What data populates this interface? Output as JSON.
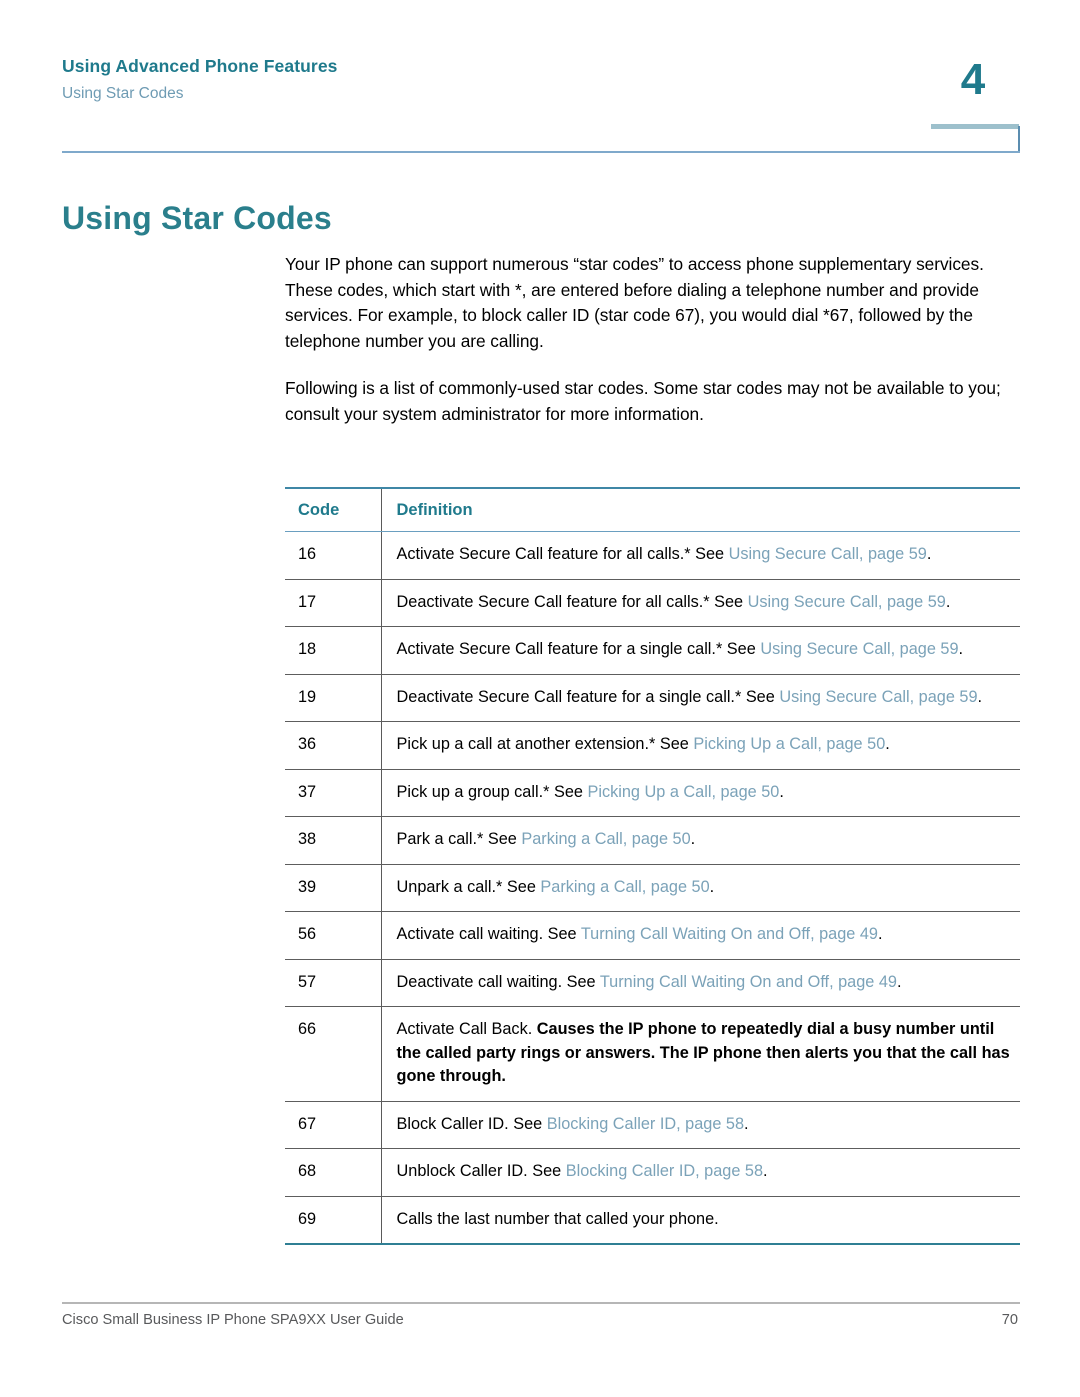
{
  "colors": {
    "heading_teal": "#2a7f8c",
    "runhead_teal": "#1f7a8c",
    "xref_blue": "#7ba2b8",
    "rule_blue": "#7fa9cb",
    "footer_gray": "#58595b"
  },
  "running_head": {
    "title": "Using Advanced Phone Features",
    "subtitle": "Using Star Codes",
    "chapter_number": "4"
  },
  "page_title": "Using Star Codes",
  "paragraphs": [
    "Your IP phone can support numerous “star codes” to access phone supplementary services. These codes, which start with *, are entered before dialing a telephone number and provide services. For example, to block caller ID (star code 67), you would dial *67, followed by the telephone number you are calling.",
    "Following is a list of commonly-used star codes. Some star codes may not be available to you; consult your system administrator for more information."
  ],
  "table": {
    "headers": {
      "code": "Code",
      "definition": "Definition"
    },
    "rows": [
      {
        "code": "16",
        "lead": "Activate Secure Call feature for all calls.* See ",
        "xref": "Using Secure Call, page 59",
        "tail": ".",
        "bold_lead": "",
        "bold_body": ""
      },
      {
        "code": "17",
        "lead": "Deactivate Secure Call feature for all calls.* See ",
        "xref": "Using Secure Call, page 59",
        "tail": ".",
        "bold_lead": "",
        "bold_body": ""
      },
      {
        "code": "18",
        "lead": "Activate Secure Call feature for a single call.* See ",
        "xref": "Using Secure Call, page 59",
        "tail": ".",
        "bold_lead": "",
        "bold_body": ""
      },
      {
        "code": "19",
        "lead": "Deactivate Secure Call feature for a single call.* See ",
        "xref": "Using Secure Call, page 59",
        "tail": ".",
        "bold_lead": "",
        "bold_body": ""
      },
      {
        "code": "36",
        "lead": "Pick up a call at another extension.* See ",
        "xref": "Picking Up a Call, page 50",
        "tail": ".",
        "bold_lead": "",
        "bold_body": ""
      },
      {
        "code": "37",
        "lead": "Pick up a group call.* See ",
        "xref": "Picking Up a Call, page 50",
        "tail": ".",
        "bold_lead": "",
        "bold_body": ""
      },
      {
        "code": "38",
        "lead": "Park a call.* See ",
        "xref": "Parking a Call, page 50",
        "tail": ".",
        "bold_lead": "",
        "bold_body": ""
      },
      {
        "code": "39",
        "lead": "Unpark a call.* See ",
        "xref": "Parking a Call, page 50",
        "tail": ".",
        "bold_lead": "",
        "bold_body": ""
      },
      {
        "code": "56",
        "lead": "Activate call waiting. See ",
        "xref": "Turning Call Waiting On and Off, page 49",
        "tail": ".",
        "bold_lead": "",
        "bold_body": ""
      },
      {
        "code": "57",
        "lead": "Deactivate call waiting. See ",
        "xref": "Turning Call Waiting On and Off, page 49",
        "tail": ".",
        "bold_lead": "",
        "bold_body": ""
      },
      {
        "code": "66",
        "lead": "Activate Call Back. ",
        "xref": "",
        "tail": "",
        "bold_lead": "",
        "bold_body": "Causes the IP phone to repeatedly dial a busy number until the called party rings or answers. The IP phone then alerts you that the call has gone through."
      },
      {
        "code": "67",
        "lead": "Block Caller ID. See ",
        "xref": "Blocking Caller ID, page 58",
        "tail": ".",
        "bold_lead": "",
        "bold_body": ""
      },
      {
        "code": "68",
        "lead": "Unblock Caller ID. See ",
        "xref": "Blocking Caller ID, page 58",
        "tail": ".",
        "bold_lead": "",
        "bold_body": ""
      },
      {
        "code": "69",
        "lead": "Calls the last number that called your phone.",
        "xref": "",
        "tail": "",
        "bold_lead": "",
        "bold_body": ""
      }
    ]
  },
  "footer": {
    "document_title": "Cisco Small Business IP Phone SPA9XX User Guide",
    "page_number": "70"
  }
}
